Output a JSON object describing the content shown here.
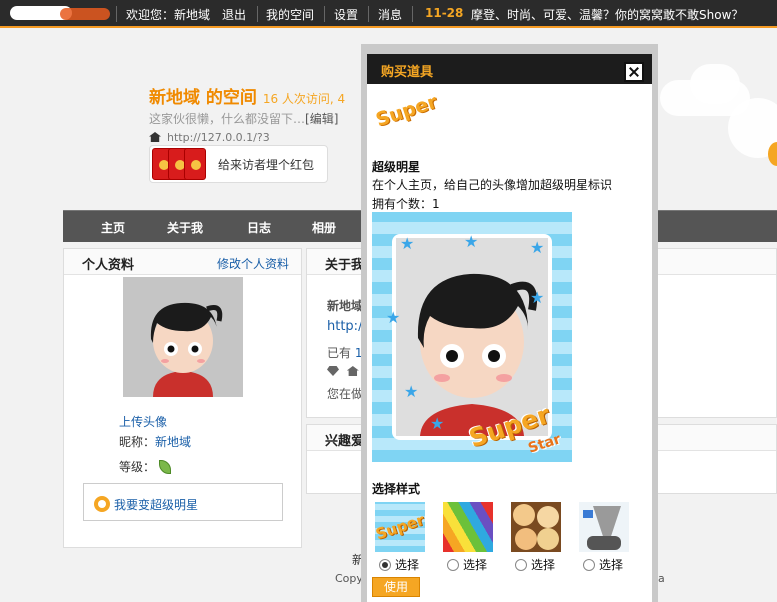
{
  "topbar": {
    "welcome": "欢迎您：新地域",
    "logout": "退出",
    "my_space": "我的空间",
    "settings": "设置",
    "messages": "消息",
    "date": "11-28",
    "slogan": "摩登、时尚、可爱、温馨？你的窝窝敢不敢Show？"
  },
  "space": {
    "title": "新地域 的空间",
    "visits": "16 人次访问, 4",
    "desc": "这家伙很懒，什么都没留下…",
    "edit": "[编辑]",
    "url": "http://127.0.0.1/?3",
    "redpack": "给来访者埋个红包"
  },
  "nav": [
    "主页",
    "关于我",
    "日志",
    "相册"
  ],
  "profile": {
    "heading": "个人资料",
    "edit_link": "修改个人资料",
    "upload_avatar": "上传头像",
    "nickname_label": "昵称：",
    "nickname": "新地域",
    "level_label": "等级：",
    "superstar_link": "我要变超级明星"
  },
  "about": {
    "heading": "关于我",
    "line1": "新地域",
    "line2": "http:/",
    "line3": "已有",
    "line3_val": "1",
    "line5": "您在做"
  },
  "interest": {
    "heading": "兴趣爱"
  },
  "footer": {
    "line1": "新",
    "line2": "Copy",
    "tail": "a"
  },
  "dialog": {
    "title": "购买道具",
    "super_logo": "Super",
    "item_name": "超级明星",
    "item_desc": "在个人主页，给自己的头像增加超级明星标识",
    "owned": "拥有个数：1",
    "preview_super": "Super",
    "preview_star": "Star",
    "styles_title": "选择样式",
    "thumb_super": "Super",
    "choose": [
      "选择",
      "选择",
      "选择",
      "选择"
    ],
    "selected_style": 1,
    "use_button": "使用"
  },
  "colors": {
    "accent": "#f5a623",
    "topbar": "#2b2b2b",
    "link": "#1a5fa8",
    "nav": "#555555"
  }
}
